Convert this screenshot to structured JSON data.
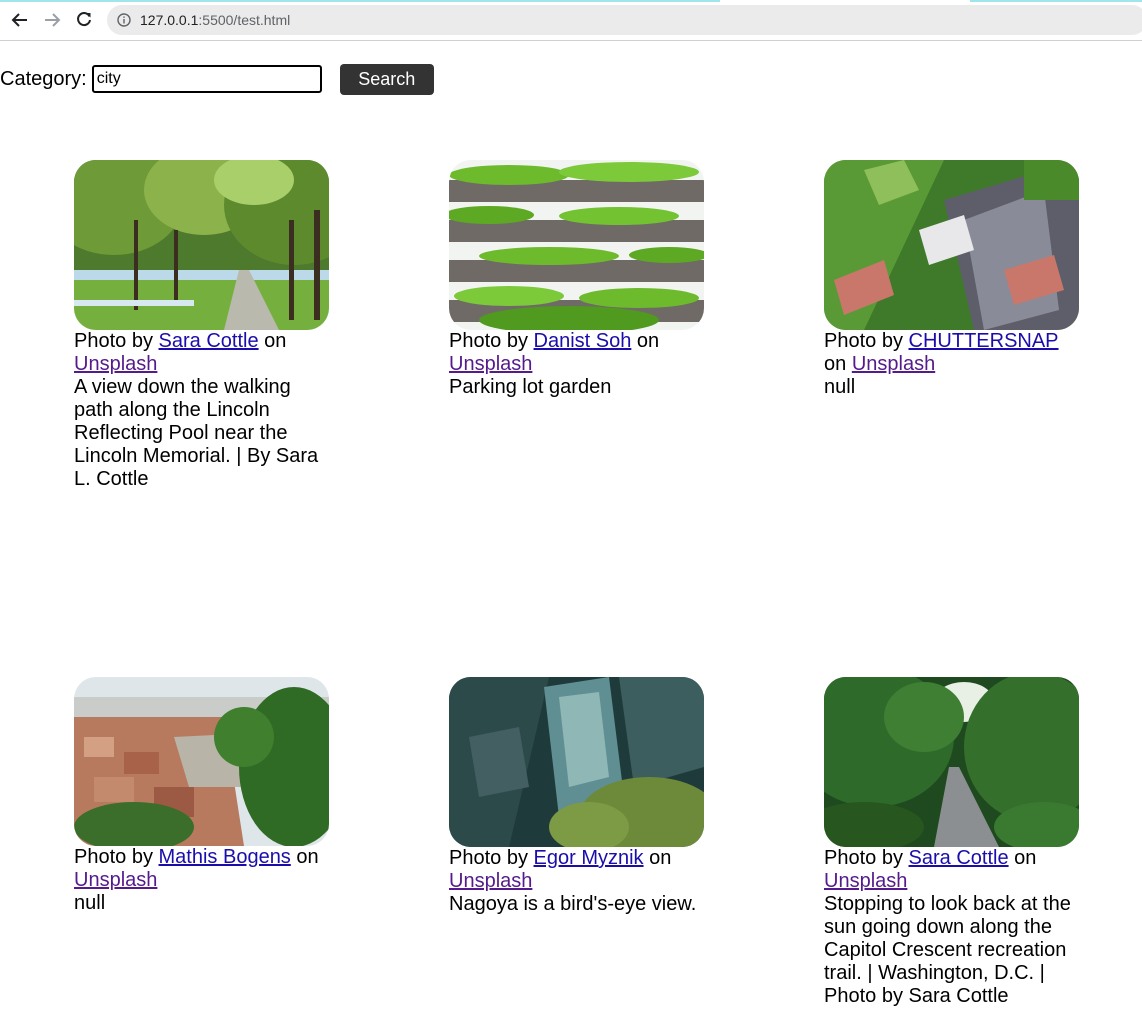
{
  "browser": {
    "url_host": "127.0.0.1",
    "url_rest": ":5500/test.html"
  },
  "form": {
    "label": "Category:",
    "value": "city",
    "button": "Search"
  },
  "cards": [
    {
      "prefix": "Photo by",
      "author": "Sara Cottle",
      "on": "on",
      "site": "Unsplash",
      "description": "A view down the walking path along the Lincoln Reflecting Pool near the Lincoln Memorial. | By Sara L. Cottle"
    },
    {
      "prefix": "Photo by",
      "author": "Danist Soh",
      "on": "on",
      "site": "Unsplash",
      "description": "Parking lot garden"
    },
    {
      "prefix": "Photo by",
      "author": "CHUTTERSNAP",
      "on": "on",
      "site": "Unsplash",
      "description": "null"
    },
    {
      "prefix": "Photo by",
      "author": "Mathis Bogens",
      "on": "on",
      "site": "Unsplash",
      "description": "null"
    },
    {
      "prefix": "Photo by",
      "author": "Egor Myznik",
      "on": "on",
      "site": "Unsplash",
      "description": "Nagoya is a bird's-eye view."
    },
    {
      "prefix": "Photo by",
      "author": "Sara Cottle",
      "on": "on",
      "site": "Unsplash",
      "description": "Stopping to look back at the sun going down along the Capitol Crescent recreation trail. | Washington, D.C. | Photo by Sara Cottle"
    }
  ]
}
